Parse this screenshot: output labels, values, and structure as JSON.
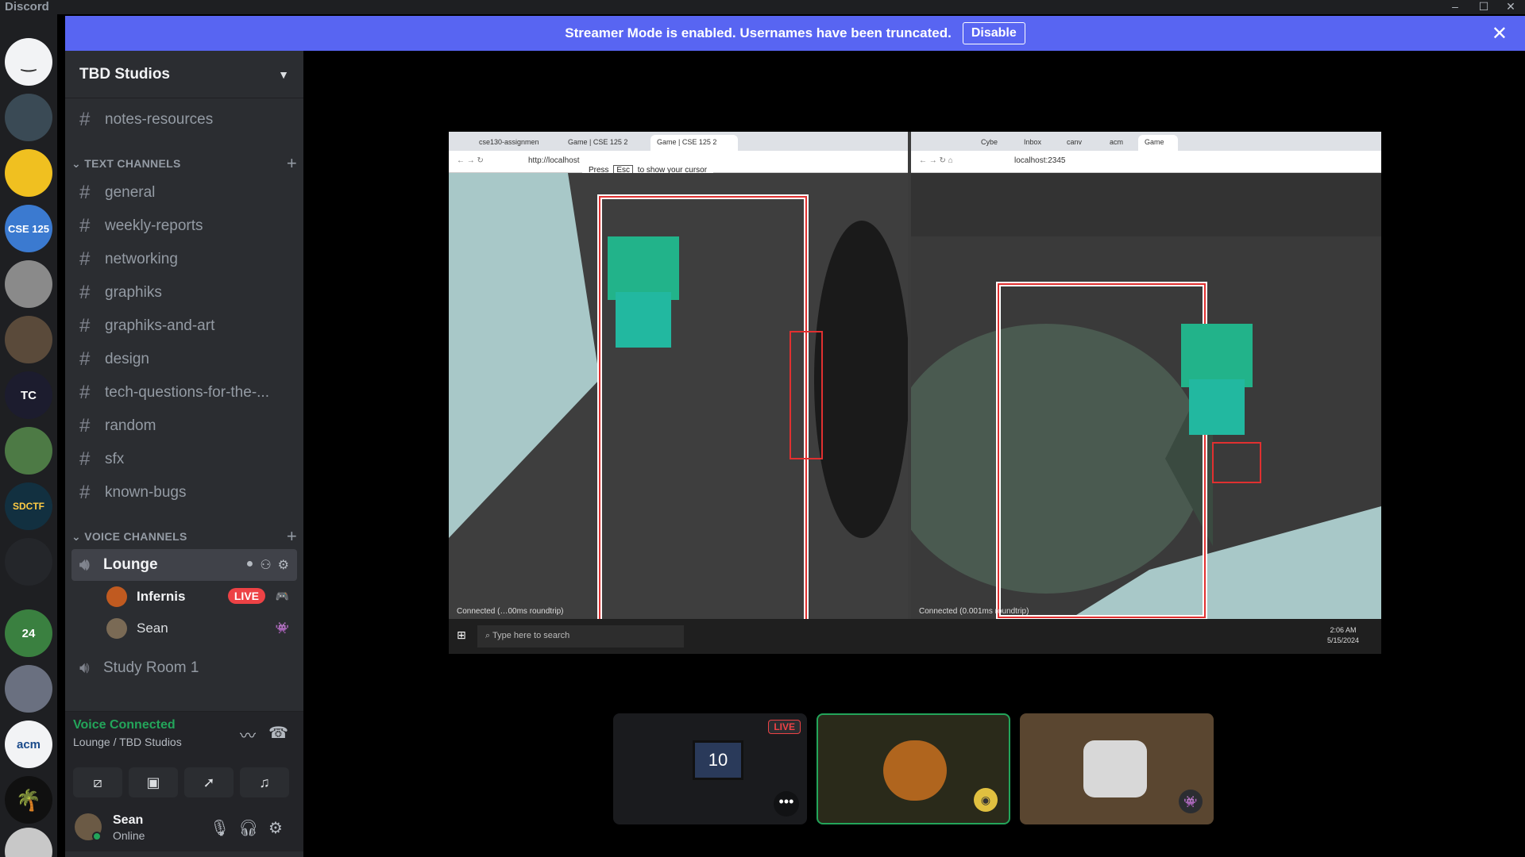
{
  "window": {
    "app_name": "Discord",
    "controls": [
      "–",
      "☐",
      "✕"
    ]
  },
  "banner": {
    "text": "Streamer Mode is enabled. Usernames have been truncated.",
    "button": "Disable"
  },
  "server": {
    "name": "TBD Studios"
  },
  "pinned_channel": "notes-resources",
  "text_category": "TEXT CHANNELS",
  "text_channels": [
    "general",
    "weekly-reports",
    "networking",
    "graphiks",
    "graphiks-and-art",
    "design",
    "tech-questions-for-the-...",
    "random",
    "sfx",
    "known-bugs"
  ],
  "voice_category": "VOICE CHANNELS",
  "voice_channels": [
    {
      "name": "Lounge"
    },
    {
      "name": "Study Room 1"
    }
  ],
  "voice_users": [
    {
      "name": "Infernis",
      "live": "LIVE"
    },
    {
      "name": "Sean"
    }
  ],
  "rail_labels": {
    "cse": "CSE 125",
    "tc": "TC",
    "sdctf": "SDCTF",
    "badge24": "24",
    "acm": "acm"
  },
  "voice_panel": {
    "status": "Voice Connected",
    "location": "Lounge / TBD Studios"
  },
  "me": {
    "name": "Sean",
    "status": "Online"
  },
  "stream": {
    "left_tabs": [
      "cse130-assignmen",
      "Game | CSE 125 2",
      "Game | CSE 125 2"
    ],
    "left_url": "http://localhost",
    "esc_hint_pre": "Press",
    "esc_hint_key": "Esc",
    "esc_hint_post": "to show your cursor",
    "right_tabs": [
      "Cybe",
      "Inbox",
      "canv",
      "acm",
      "Game"
    ],
    "right_url": "localhost:2345",
    "left_conn": "Connected (…00ms roundtrip)",
    "right_conn": "Connected (0.001ms roundtrip)",
    "taskbar_search": "Type here to search",
    "clock_time": "2:06 AM",
    "clock_date": "5/15/2024"
  },
  "tiles": {
    "live": "LIVE",
    "cam_label": "10"
  }
}
